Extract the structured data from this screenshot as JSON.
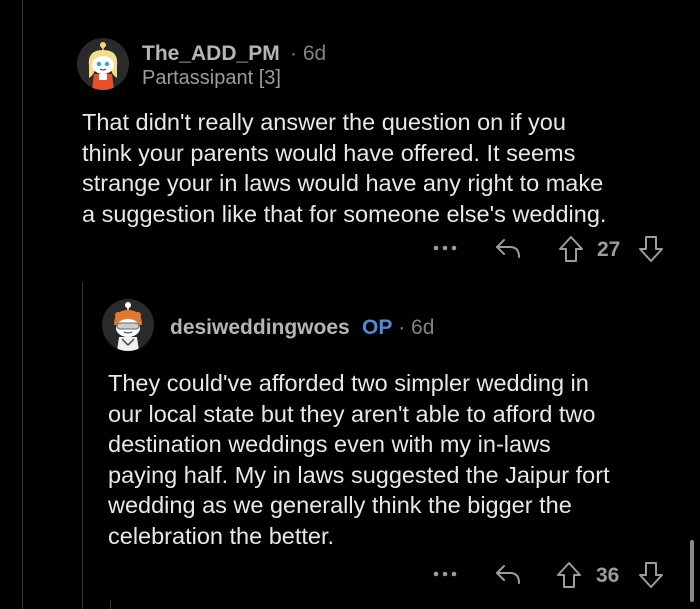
{
  "comments": [
    {
      "username": "The_ADD_PM",
      "separator": "·",
      "age": "6d",
      "flair": "Partassipant [3]",
      "avatar_icon": "blonde-girl-avatar-icon",
      "body_lines": [
        "That didn't really answer the question on if you",
        "think your parents would have offered. It seems",
        "strange your in laws would have any right to make",
        "a suggestion like that for someone else's wedding."
      ],
      "votes": "27"
    },
    {
      "username": "desiweddingwoes",
      "op_badge": "OP",
      "separator": "·",
      "age": "6d",
      "avatar_icon": "orange-hair-avatar-icon",
      "body_lines": [
        "They could've afforded two simpler wedding in",
        "our local state but they aren't able to afford two",
        "destination weddings even with my in-laws",
        "paying half. My in laws suggested the Jaipur fort",
        "wedding as we generally think the bigger the",
        "celebration the better."
      ],
      "votes": "36"
    }
  ],
  "colors": {
    "background": "#000000",
    "op_badge": "#4d8bd6",
    "text": "#e6e8e9",
    "meta": "#818384"
  },
  "icons": [
    "more-options-icon",
    "reply-icon",
    "upvote-icon",
    "downvote-icon"
  ]
}
